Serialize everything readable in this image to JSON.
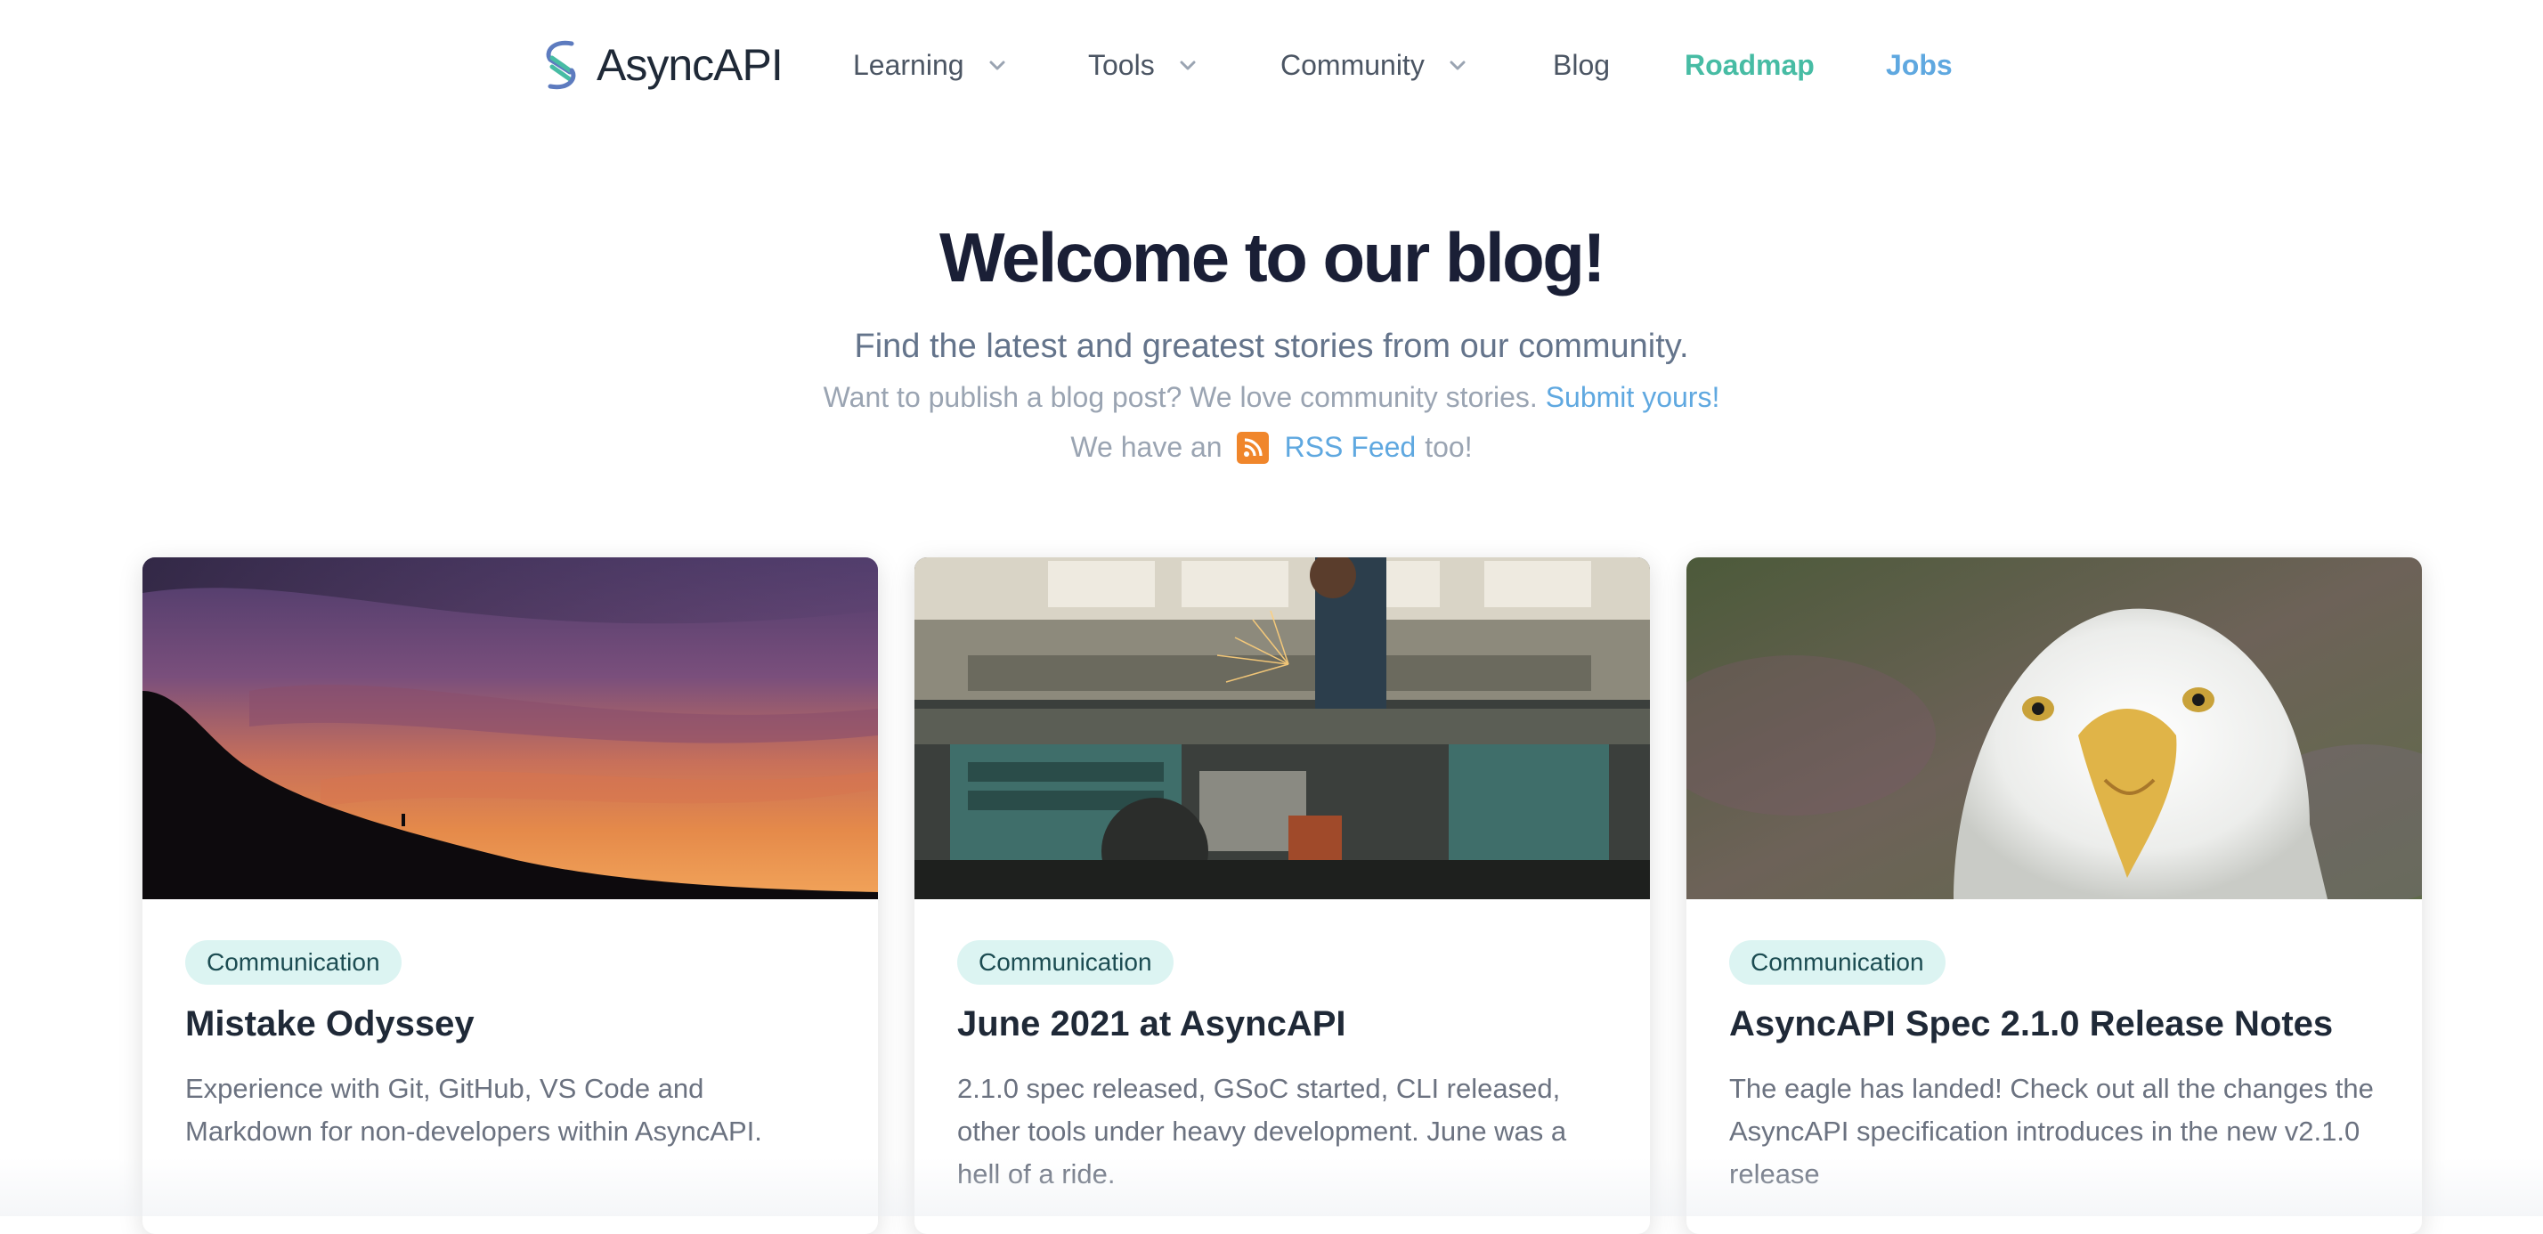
{
  "nav": {
    "logo_text": "AsyncAPI",
    "items": [
      {
        "label": "Learning",
        "has_dropdown": true
      },
      {
        "label": "Tools",
        "has_dropdown": true
      },
      {
        "label": "Community",
        "has_dropdown": true
      },
      {
        "label": "Blog",
        "has_dropdown": false
      },
      {
        "label": "Roadmap",
        "has_dropdown": false,
        "color": "#47bca4"
      },
      {
        "label": "Jobs",
        "has_dropdown": false,
        "color": "#5fa8e0"
      }
    ]
  },
  "hero": {
    "title": "Welcome to our blog!",
    "subtitle": "Find the latest and greatest stories from our community.",
    "publish_prompt": "Want to publish a blog post? We love community stories.",
    "publish_link": "Submit yours!",
    "rss_prefix": "We have an",
    "rss_link": "RSS Feed",
    "rss_suffix": "too!"
  },
  "posts": [
    {
      "tag": "Communication",
      "title": "Mistake Odyssey",
      "excerpt": "Experience with Git, GitHub, VS Code and Markdown for non-developers within AsyncAPI.",
      "image": "sunset-mountain-silhouette"
    },
    {
      "tag": "Communication",
      "title": "June 2021 at AsyncAPI",
      "excerpt": "2.1.0 spec released, GSoC started, CLI released, other tools under heavy development. June was a hell of a ride.",
      "image": "workshop-grinder-sparks"
    },
    {
      "tag": "Communication",
      "title": "AsyncAPI Spec 2.1.0 Release Notes",
      "excerpt": "The eagle has landed! Check out all the changes the AsyncAPI specification introduces in the new v2.1.0 release",
      "image": "bald-eagle-head"
    }
  ],
  "colors": {
    "accent_green": "#47bca4",
    "accent_blue": "#5fa8e0",
    "rss_orange": "#f0862b",
    "tag_bg": "#dcf4f2"
  }
}
